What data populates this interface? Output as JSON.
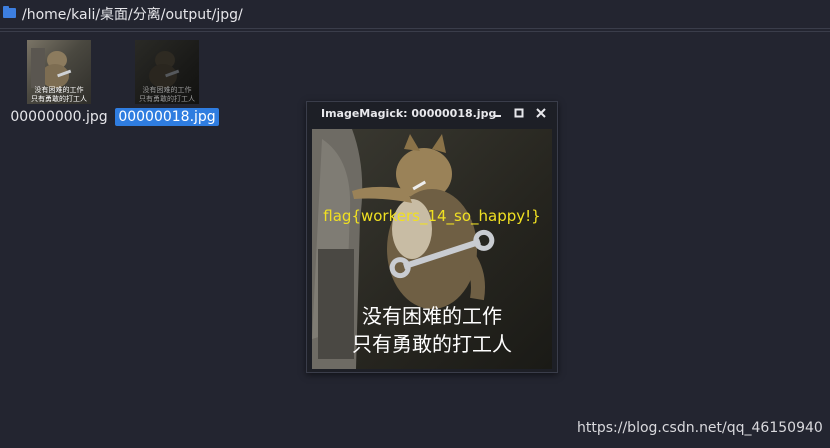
{
  "path_bar": {
    "path": "/home/kali/桌面/分离/output/jpg/"
  },
  "files": [
    {
      "name": "00000000.jpg",
      "selected": false,
      "thumb_caption_1": "没有困难的工作",
      "thumb_caption_2": "只有勇敢的打工人"
    },
    {
      "name": "00000018.jpg",
      "selected": true,
      "thumb_caption_1": "没有困难的工作",
      "thumb_caption_2": "只有勇敢的打工人"
    }
  ],
  "viewer": {
    "title": "ImageMagick: 00000018.jpg",
    "minimize_icon": "minimize-icon",
    "maximize_icon": "maximize-icon",
    "close_icon": "close-icon",
    "flag_text": "flag{workers_14_so_happy!}",
    "caption_line1": "没有困难的工作",
    "caption_line2": "只有勇敢的打工人",
    "flag_color": "#f0e022"
  },
  "watermark": "https://blog.csdn.net/qq_46150940",
  "colors": {
    "accent": "#2f7de0",
    "background": "#232530"
  }
}
